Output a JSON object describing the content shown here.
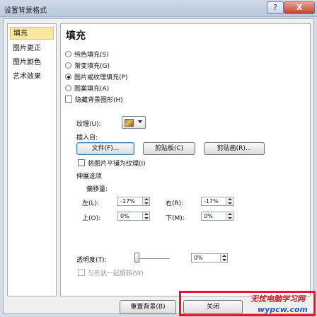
{
  "window": {
    "title": "设置背景格式",
    "help_label": "?",
    "close_label": "X"
  },
  "nav": {
    "items": [
      "填充",
      "图片更正",
      "图片颜色",
      "艺术效果"
    ],
    "selected": 0
  },
  "fill": {
    "heading": "填充",
    "options": [
      "纯色填充(S)",
      "渐变填充(G)",
      "图片或纹理填充(P)",
      "图案填充(A)"
    ],
    "selected_option": 2,
    "hide_bg_graphics": "隐藏背景图形(H)"
  },
  "texture": {
    "label": "纹理(U):",
    "swatch": "wood-texture-swatch"
  },
  "insert_from": {
    "label": "插入自:",
    "buttons": [
      "文件(F)...",
      "剪贴板(C)",
      "剪贴画(R)..."
    ]
  },
  "tile": {
    "label": "将图片平铺为纹理(I)"
  },
  "stretch": {
    "section": "伸展选项",
    "offset_label": "偏移量:",
    "left_label": "左(L):",
    "left_value": "-17%",
    "right_label": "右(R):",
    "right_value": "-17%",
    "top_label": "上(O):",
    "top_value": "0%",
    "bottom_label": "下(M):",
    "bottom_value": "0%"
  },
  "transparency": {
    "label": "透明度(T):",
    "value": "0%",
    "level": 0
  },
  "rotate_with_shape": {
    "label": "与形状一起旋转(W)"
  },
  "footer": {
    "reset_label": "重置背景(B)",
    "close_label": "关闭"
  },
  "watermark": {
    "top": "无忧电脑学习网",
    "bottom": "wypcw.com"
  },
  "colors": {
    "accent_highlight": "#e5192a",
    "nav_selected": "#fbe8a0"
  }
}
